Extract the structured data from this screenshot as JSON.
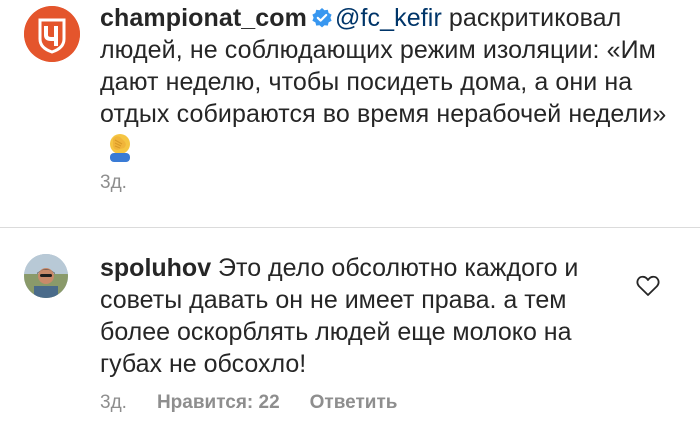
{
  "post": {
    "username": "championat_com",
    "mention": "@fc_kefir",
    "text_before": " раскритиковал людей, не соблюдающих режим изоляции: «Им дают неделю, чтобы посидеть дома, а они на отдых собираются во время нерабочей недели» ",
    "emoji": "🤦",
    "time": "3д."
  },
  "comment": {
    "username": "spoluhov",
    "text": " Это дело обсолютно каждого и советы давать он не имеет права. а тем более оскорблять людей еще молоко на губах не обсохло!",
    "time": "3д.",
    "likes": "Нравится: 22",
    "reply": "Ответить"
  },
  "colors": {
    "brand": "#e4552c",
    "verified": "#3897f0",
    "mention": "#003569",
    "meta": "#8e8e8e"
  },
  "icons": [
    "championat-logo",
    "verified-badge",
    "face-palm-emoji",
    "heart-icon"
  ]
}
